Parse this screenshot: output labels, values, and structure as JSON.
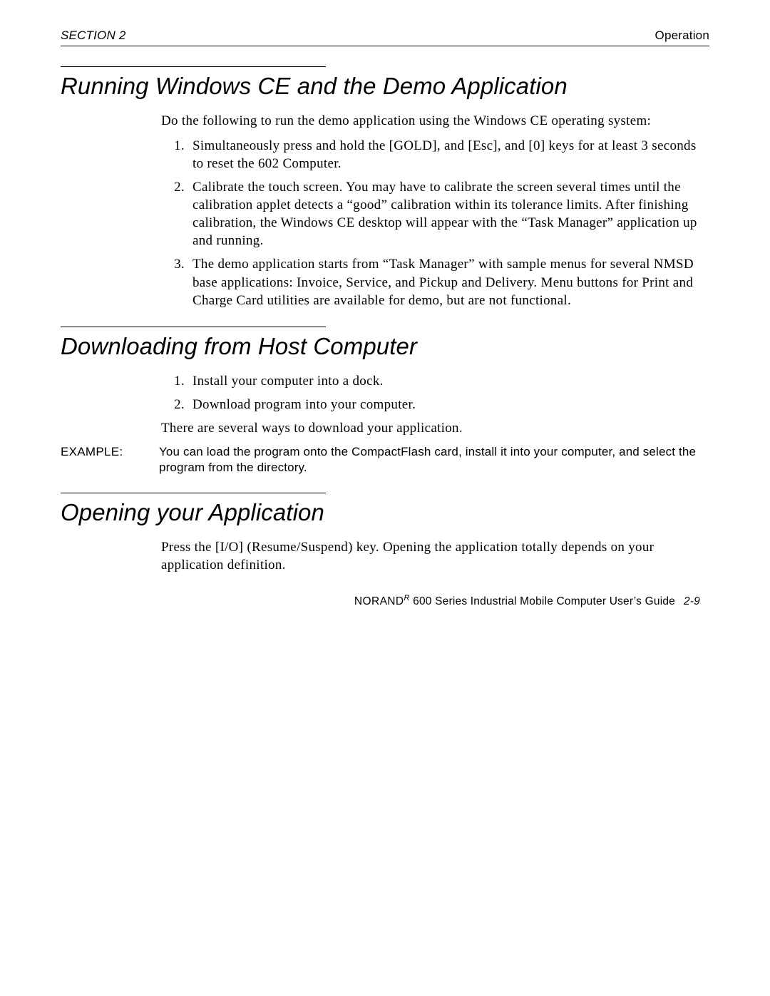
{
  "header": {
    "left": "SECTION 2",
    "right": "Operation"
  },
  "sections": {
    "s1": {
      "title": "Running Windows CE and the Demo Application",
      "intro": "Do the following to run the demo application using the Windows CE operating system:",
      "items": [
        "Simultaneously press and hold the [GOLD], and [Esc], and [0] keys for at least 3 seconds to reset the 602 Computer.",
        "Calibrate the touch screen.  You may have to calibrate the screen several times until the calibration applet detects a “good” calibration within its tolerance limits.  After finishing calibration, the Windows CE desktop will appear with the “Task Manager” application up and running.",
        "The demo application starts from “Task Manager” with sample menus for several NMSD base applications:  Invoice, Service, and Pickup and Delivery.  Menu buttons for Print and Charge Card utilities are available for demo, but are not functional."
      ]
    },
    "s2": {
      "title": "Downloading from Host Computer",
      "items": [
        "Install your computer into a dock.",
        "Download program into your computer."
      ],
      "after": "There are several ways to download your application.",
      "example_label": "EXAMPLE:",
      "example_body": "You can load the program onto the CompactFlash card, install it into your computer, and select the program from the directory."
    },
    "s3": {
      "title": "Opening your Application",
      "body": "Press the [I/O] (Resume/Suspend) key. Opening the application totally depends on your application definition."
    }
  },
  "footer": {
    "brand": "NORAND",
    "sup": "R",
    "text": " 600 Series Industrial Mobile Computer User’s Guide",
    "page": "2-9"
  }
}
